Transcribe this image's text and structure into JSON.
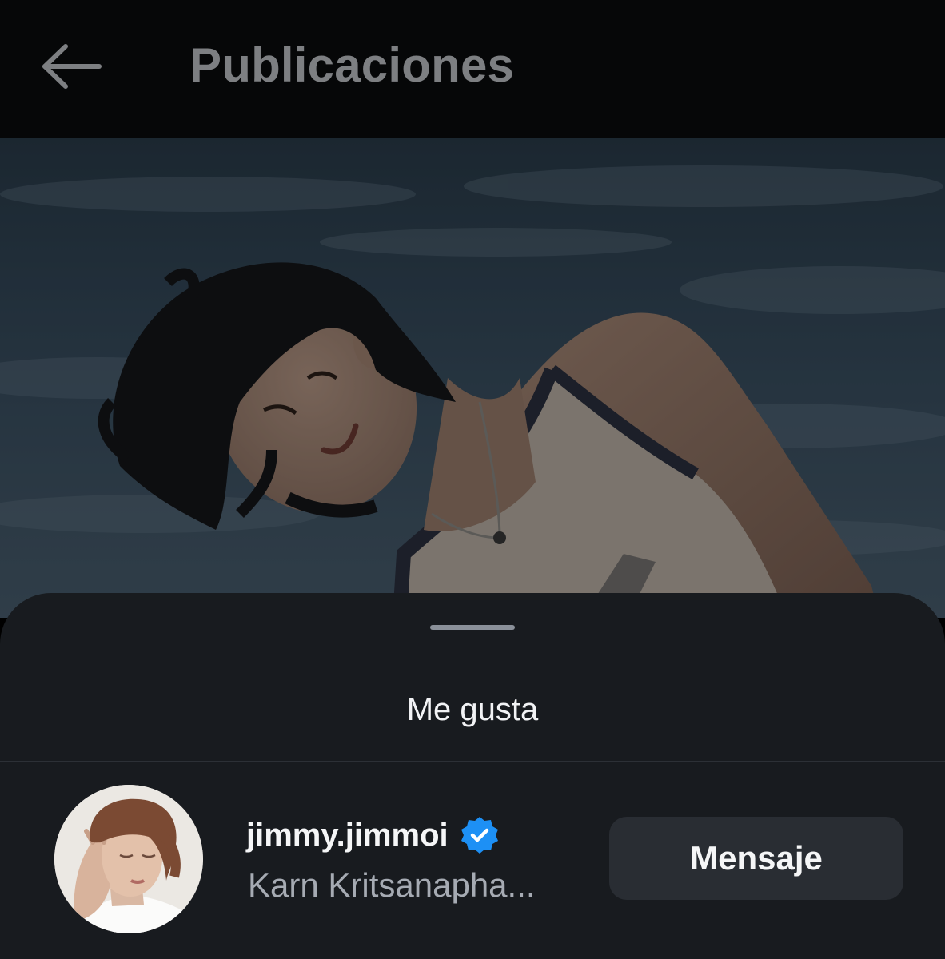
{
  "header": {
    "back_icon": "arrow-left-icon",
    "title": "Publicaciones"
  },
  "post": {
    "image_description_icon": "post-photo"
  },
  "likes_sheet": {
    "title": "Me gusta",
    "user": {
      "username": "jimmy.jimmoi",
      "full_name": "Karn Kritsanapha...",
      "verified": true,
      "verified_icon": "verified-badge-icon",
      "message_button_label": "Mensaje"
    }
  },
  "colors": {
    "header_bg": "#060708",
    "sheet_bg": "#181b1f",
    "button_bg": "#292d33",
    "verified_blue": "#1d90f5",
    "title_gray": "#7d7f82"
  }
}
